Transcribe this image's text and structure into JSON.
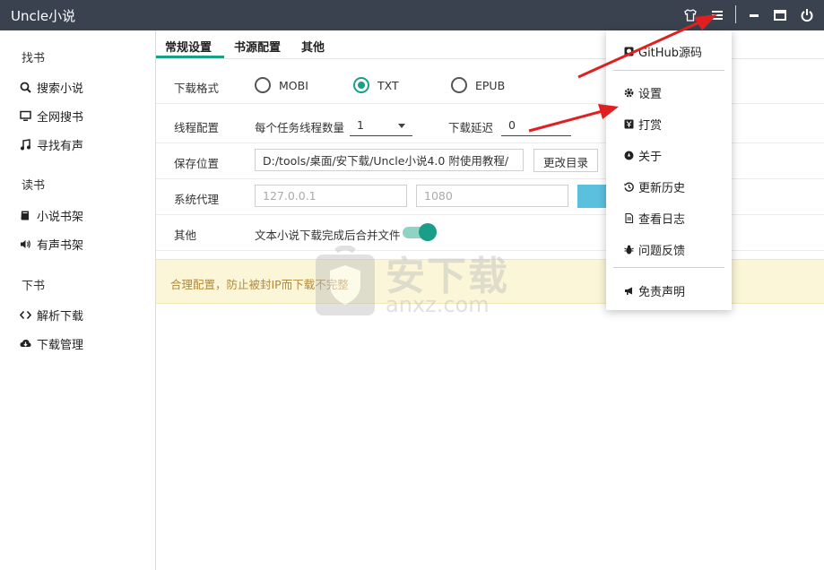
{
  "app": {
    "title": "Uncle小说"
  },
  "titlebar": {
    "skin_icon": "tshirt-icon",
    "menu_icon": "hamburger-menu-icon",
    "minimize_icon": "minimize-icon",
    "maximize_icon": "maximize-icon",
    "power_icon": "power-icon"
  },
  "sidebar": {
    "sections": [
      {
        "title": "找书",
        "items": [
          {
            "label": "搜索小说",
            "icon": "search-icon"
          },
          {
            "label": "全网搜书",
            "icon": "monitor-icon"
          },
          {
            "label": "寻找有声",
            "icon": "music-icon"
          }
        ]
      },
      {
        "title": "读书",
        "items": [
          {
            "label": "小说书架",
            "icon": "book-icon"
          },
          {
            "label": "有声书架",
            "icon": "volume-icon"
          }
        ]
      },
      {
        "title": "下书",
        "items": [
          {
            "label": "解析下载",
            "icon": "code-icon"
          },
          {
            "label": "下载管理",
            "icon": "cloud-download-icon"
          }
        ]
      }
    ]
  },
  "tabs": [
    {
      "label": "常规设置",
      "active": true
    },
    {
      "label": "书源配置"
    },
    {
      "label": "其他"
    }
  ],
  "settings": {
    "format": {
      "label": "下载格式",
      "options": [
        "MOBI",
        "TXT",
        "EPUB"
      ],
      "selected": "TXT"
    },
    "threads": {
      "label": "线程配置",
      "per_task_label": "每个任务线程数量",
      "per_task_value": "1",
      "delay_label": "下载延迟",
      "delay_value": "0"
    },
    "save": {
      "label": "保存位置",
      "path": "D:/tools/桌面/安下载/Uncle小说4.0 附使用教程/",
      "change_button": "更改目录"
    },
    "proxy": {
      "label": "系统代理",
      "host_placeholder": "127.0.0.1",
      "port_placeholder": "1080"
    },
    "other": {
      "label": "其他",
      "merge_label": "文本小说下载完成后合并文件",
      "merge_enabled": true
    }
  },
  "notice": {
    "text": "合理配置，防止被封IP而下载不完整"
  },
  "watermark": {
    "cn": "安下载",
    "en": "anxz.com"
  },
  "dropdown": {
    "items": [
      {
        "label": "GitHub源码",
        "icon": "github-icon"
      },
      {
        "label": "设置",
        "icon": "gear-icon"
      },
      {
        "label": "打赏",
        "icon": "yen-icon"
      },
      {
        "label": "关于",
        "icon": "compass-icon"
      },
      {
        "label": "更新历史",
        "icon": "history-icon"
      },
      {
        "label": "查看日志",
        "icon": "file-icon"
      },
      {
        "label": "问题反馈",
        "icon": "bug-icon"
      },
      {
        "label": "免责声明",
        "icon": "megaphone-icon"
      }
    ]
  },
  "colors": {
    "accent": "#1a9e88",
    "titlebar": "#3a4250",
    "notice_bg": "#fbf6d8",
    "annotation_arrow": "#e02020"
  }
}
